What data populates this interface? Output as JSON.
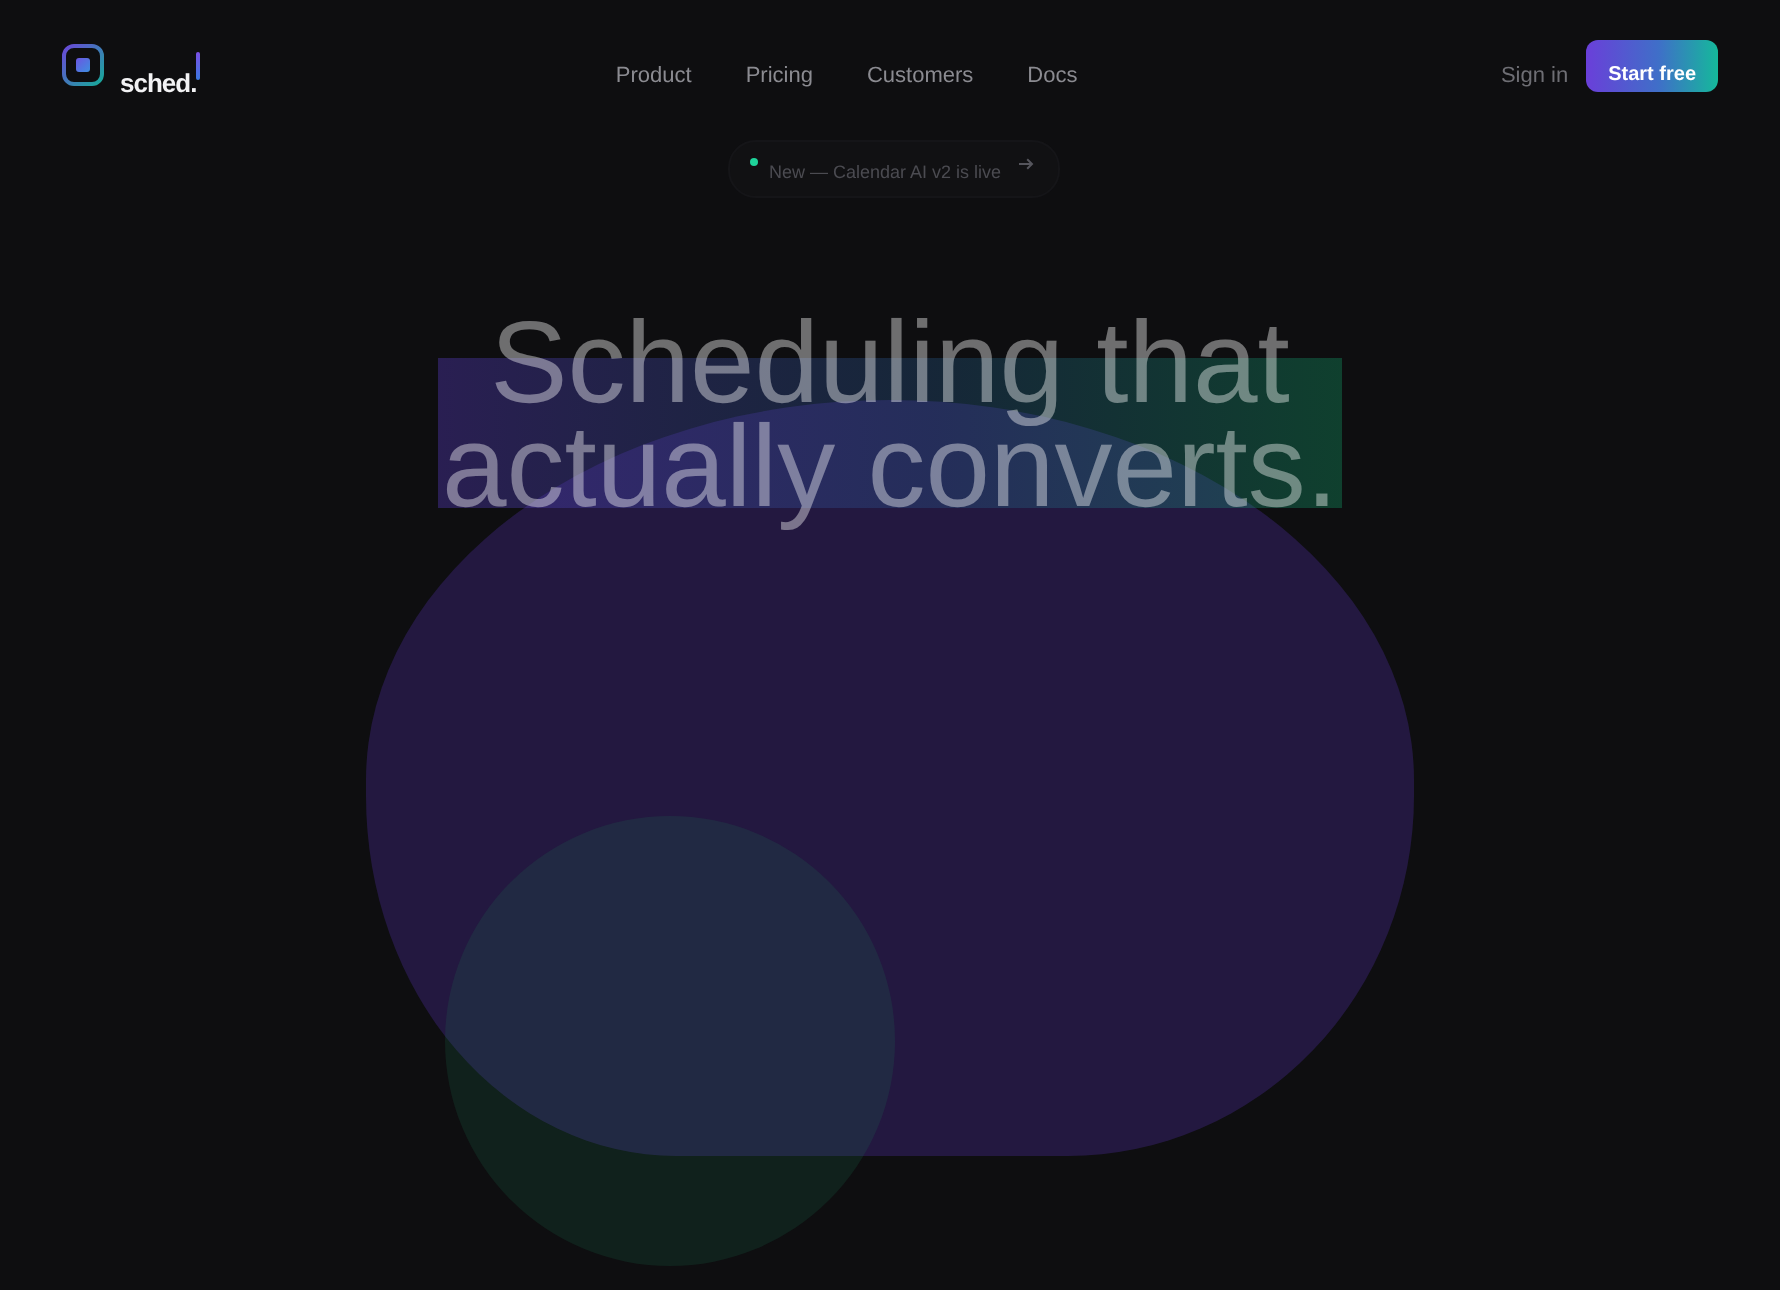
{
  "brand": {
    "name": "sched."
  },
  "nav": {
    "links": [
      {
        "label": "Product"
      },
      {
        "label": "Pricing"
      },
      {
        "label": "Customers"
      },
      {
        "label": "Docs"
      }
    ]
  },
  "actions": {
    "sign_in": "Sign in",
    "cta": "Start free"
  },
  "announcement": {
    "text": "New — Calendar AI v2 is live"
  },
  "hero": {
    "title_lines": [
      "Scheduling that",
      "actually converts."
    ]
  }
}
